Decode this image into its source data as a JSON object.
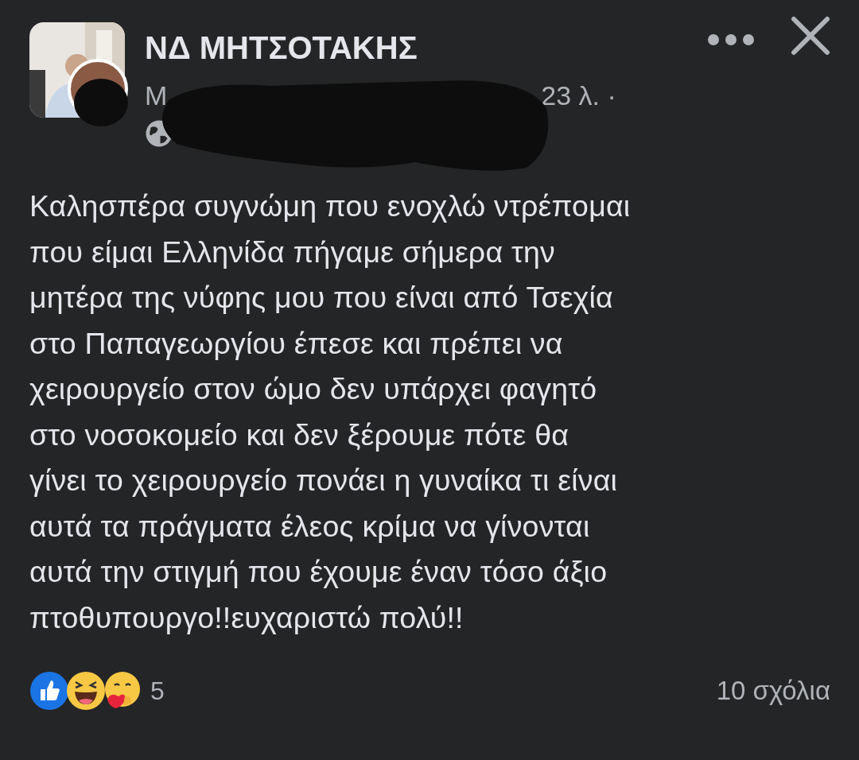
{
  "post": {
    "group_name": "ΝΔ ΜΗΤΣΟΤΑΚΗΣ",
    "author_initial": "Μ",
    "time": "23 λ. ·",
    "body": "Καλησπέρα συγνώμη που ενοχλώ ντρέπομαι\nπου είμαι Ελληνίδα πήγαμε σήμερα την\nμητέρα της νύφης μου που είναι από Τσεχία\nστο Παπαγεωργίου έπεσε και πρέπει να\nχειρουργείο στον ώμο δεν υπάρχει φαγητό\nστο νοσοκομείο και δεν ξέρουμε πότε θα\nγίνει το χειρουργείο πονάει η γυναίκα τι είναι\nαυτά τα πράγματα έλεος κρίμα να γίνονται\nαυτά την στιγμή που έχουμε έναν τόσο άξιο\nπτοθυπουργο!!ευχαριστώ πολύ!!",
    "reaction_count": "5",
    "comments": "10 σχόλια"
  }
}
